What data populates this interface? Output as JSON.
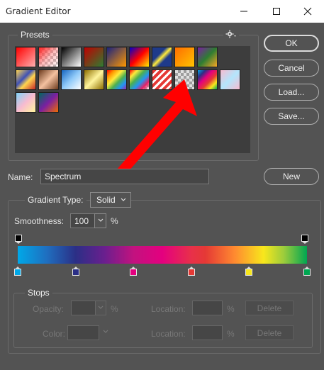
{
  "window": {
    "title": "Gradient Editor"
  },
  "presets": {
    "legend": "Presets"
  },
  "buttons": {
    "ok": "OK",
    "cancel": "Cancel",
    "load": "Load...",
    "save": "Save...",
    "new": "New"
  },
  "name": {
    "label": "Name:",
    "value": "Spectrum"
  },
  "gradient": {
    "legend_label": "Gradient Type:",
    "type_value": "Solid",
    "smoothness_label": "Smoothness:",
    "smoothness_value": "100",
    "percent": "%"
  },
  "stops": {
    "legend": "Stops",
    "opacity_label": "Opacity:",
    "color_label": "Color:",
    "location_label": "Location:",
    "percent": "%",
    "delete_label": "Delete",
    "color_stops": [
      "#00a8e8",
      "#2b2f86",
      "#e4007f",
      "#e53935",
      "#f8e71c",
      "#00a651"
    ]
  }
}
